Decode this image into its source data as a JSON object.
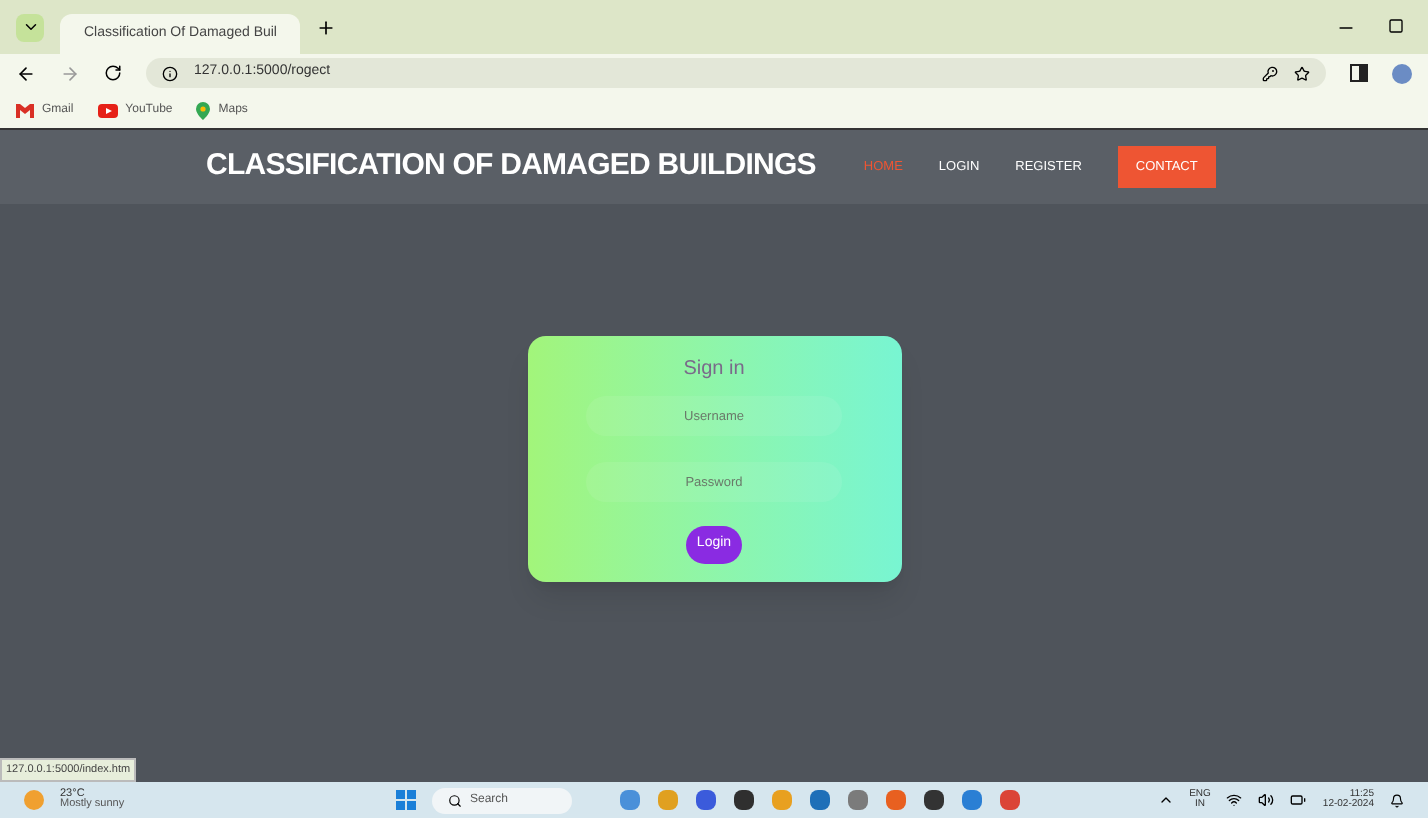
{
  "browser": {
    "tab_title": "Classification Of Damaged Buil",
    "url": "127.0.0.1:5000/rogect",
    "bookmarks": [
      {
        "label": "Gmail",
        "kind": "gmail"
      },
      {
        "label": "YouTube",
        "kind": "youtube"
      },
      {
        "label": "Maps",
        "kind": "maps"
      }
    ]
  },
  "header": {
    "title": "CLASSIFICATION OF DAMAGED BUILDINGS",
    "nav": [
      {
        "label": "HOME",
        "selected": true,
        "kind": "link"
      },
      {
        "label": "LOGIN",
        "selected": false,
        "kind": "link"
      },
      {
        "label": "REGISTER",
        "selected": false,
        "kind": "link"
      },
      {
        "label": "CONTACT",
        "selected": false,
        "kind": "button"
      }
    ]
  },
  "sign_in": {
    "title": "Sign in",
    "fields": [
      {
        "placeholder": "Username"
      },
      {
        "placeholder": "Password"
      }
    ],
    "button": "Login"
  },
  "status_url": "127.0.0.1:5000/index.htm",
  "taskbar": {
    "weather": {
      "temp": "23°C",
      "condition": "Mostly sunny"
    },
    "search": {
      "placeholder": "Search"
    },
    "tray": {
      "lang": "ENG",
      "region": "IN",
      "time": "11:25",
      "date": "12-02-2024"
    }
  }
}
